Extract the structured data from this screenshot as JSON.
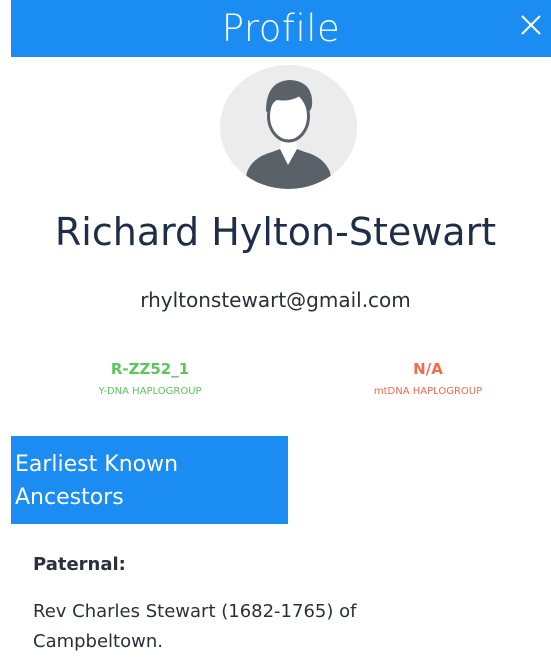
{
  "colors": {
    "accent": "#1a8cf2",
    "y_dna": "#5ec45e",
    "mt_dna": "#f36a4c"
  },
  "header": {
    "title": "Profile",
    "close_icon": "close-icon"
  },
  "profile": {
    "avatar_icon": "user-avatar-icon",
    "name": "Richard Hylton-Stewart",
    "email": "rhyltonstewart@gmail.com"
  },
  "haplogroups": {
    "y_dna": {
      "value": "R-ZZ52_1",
      "label": "Y-DNA HAPLOGROUP"
    },
    "mt_dna": {
      "value": "N/A",
      "label": "mtDNA HAPLOGROUP"
    }
  },
  "ancestors": {
    "heading": "Earliest Known Ancestors",
    "paternal_label": "Paternal:",
    "paternal_text": "Rev Charles Stewart (1682-1765) of Campbeltown."
  }
}
